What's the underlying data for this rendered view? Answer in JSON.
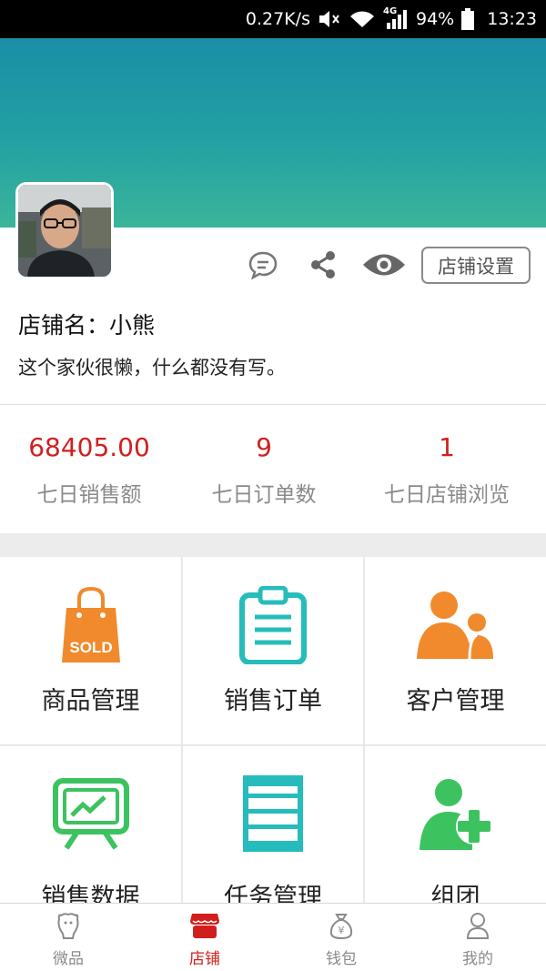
{
  "status_bar": {
    "speed": "0.27K/s",
    "network": "4G",
    "battery": "94%",
    "time": "13:23"
  },
  "actions": {
    "settings_label": "店铺设置"
  },
  "shop": {
    "name": "店铺名：小熊",
    "description": "这个家伙很懒，什么都没有写。"
  },
  "stats": [
    {
      "value": "68405.00",
      "label": "七日销售额"
    },
    {
      "value": "9",
      "label": "七日订单数"
    },
    {
      "value": "1",
      "label": "七日店铺浏览"
    }
  ],
  "grid": [
    {
      "label": "商品管理",
      "icon": "sold-bag-icon",
      "color": "#f08a2c",
      "badge": "SOLD"
    },
    {
      "label": "销售订单",
      "icon": "clipboard-icon",
      "color": "#26bcbc"
    },
    {
      "label": "客户管理",
      "icon": "customers-icon",
      "color": "#f08a2c"
    },
    {
      "label": "销售数据",
      "icon": "chart-board-icon",
      "color": "#3cc35f"
    },
    {
      "label": "任务管理",
      "icon": "task-list-icon",
      "color": "#26bcbc"
    },
    {
      "label": "组团",
      "icon": "add-user-icon",
      "color": "#3cc35f"
    }
  ],
  "tabs": [
    {
      "label": "微品",
      "icon": "bear-icon"
    },
    {
      "label": "店铺",
      "icon": "shop-icon",
      "active": true
    },
    {
      "label": "钱包",
      "icon": "money-bag-icon"
    },
    {
      "label": "我的",
      "icon": "person-icon"
    }
  ],
  "colors": {
    "accent": "#d0201e",
    "banner_top": "#1a8ea6",
    "banner_bottom": "#3bb59a"
  }
}
